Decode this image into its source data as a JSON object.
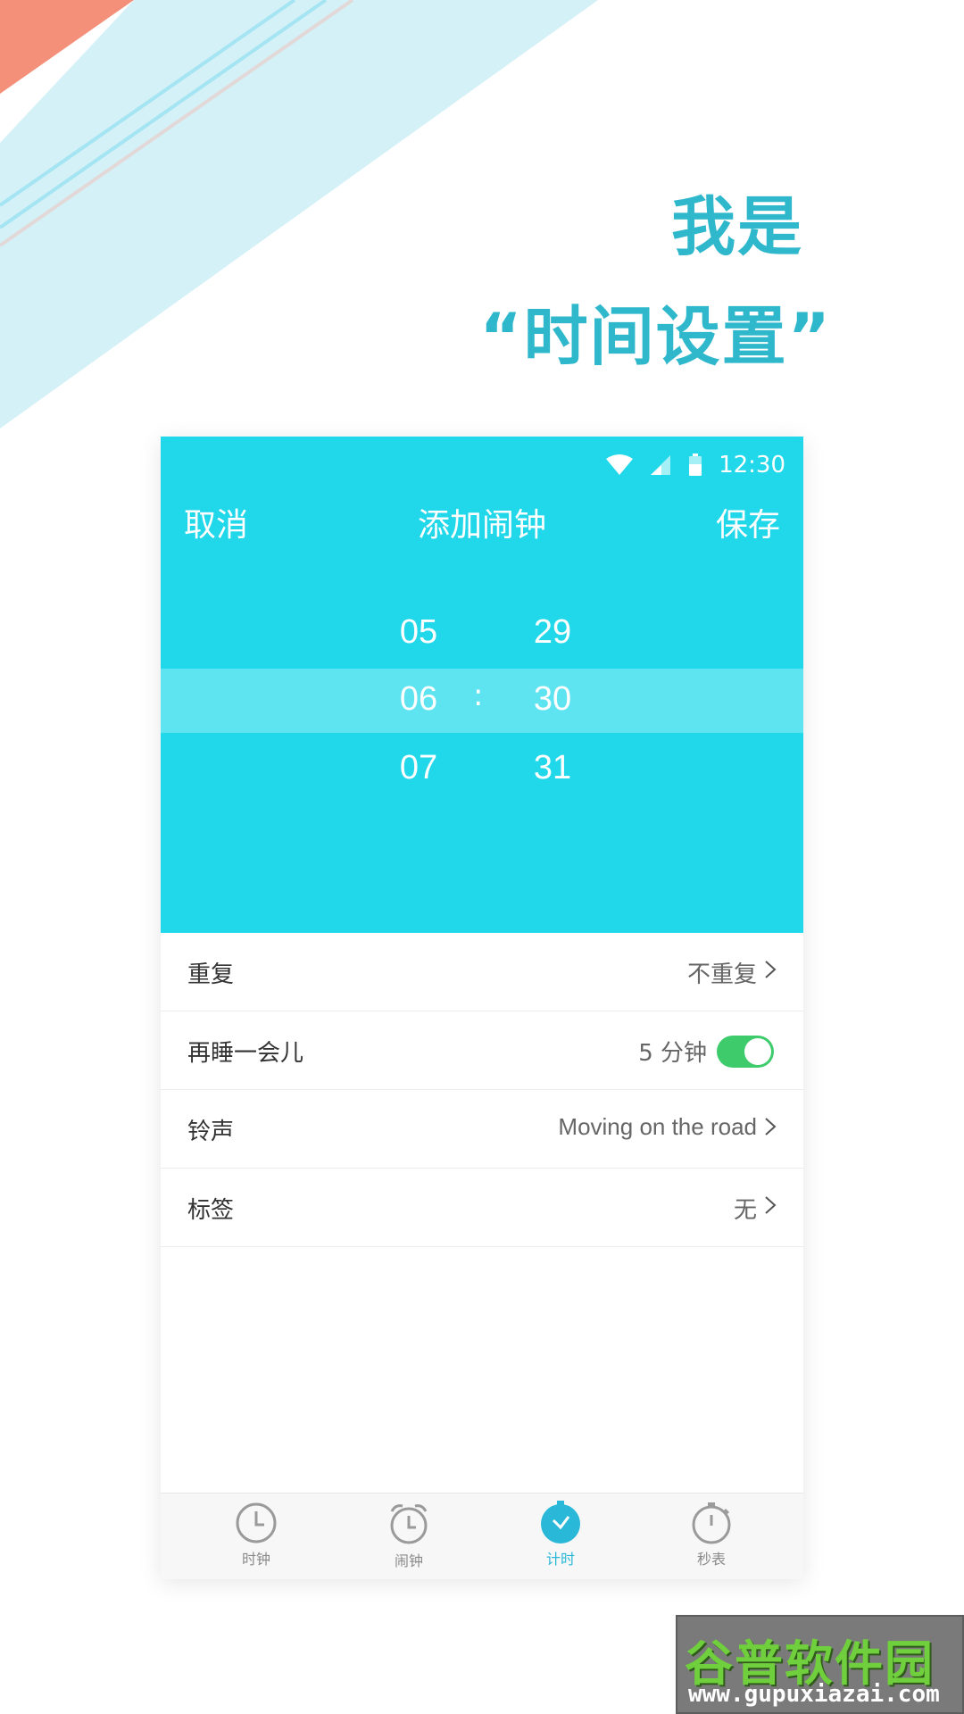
{
  "promo": {
    "line1": "我是",
    "line2": "“时间设置”"
  },
  "status": {
    "time": "12:30"
  },
  "nav": {
    "cancel": "取消",
    "title": "添加闹钟",
    "save": "保存"
  },
  "picker": {
    "hours": [
      "05",
      "06",
      "07"
    ],
    "minutes": [
      "29",
      "30",
      "31"
    ],
    "separator": ":"
  },
  "settings": {
    "repeat": {
      "label": "重复",
      "value": "不重复"
    },
    "snooze": {
      "label": "再睡一会儿",
      "value": "5 分钟",
      "enabled": true
    },
    "ringtone": {
      "label": "铃声",
      "value": "Moving on the road"
    },
    "tag": {
      "label": "标签",
      "value": "无"
    }
  },
  "tabs": [
    {
      "label": "时钟",
      "icon": "clock-icon"
    },
    {
      "label": "闹钟",
      "icon": "alarm-icon"
    },
    {
      "label": "计时",
      "icon": "timer-icon",
      "active": true
    },
    {
      "label": "秒表",
      "icon": "stopwatch-icon"
    }
  ],
  "colors": {
    "accent": "#20d8ea",
    "headline": "#2fb8cc",
    "toggle": "#3ecb6b",
    "active_tab": "#29b8d8"
  },
  "watermark": {
    "main": "谷普软件园",
    "sub": "www.gupuxiazai.com"
  }
}
